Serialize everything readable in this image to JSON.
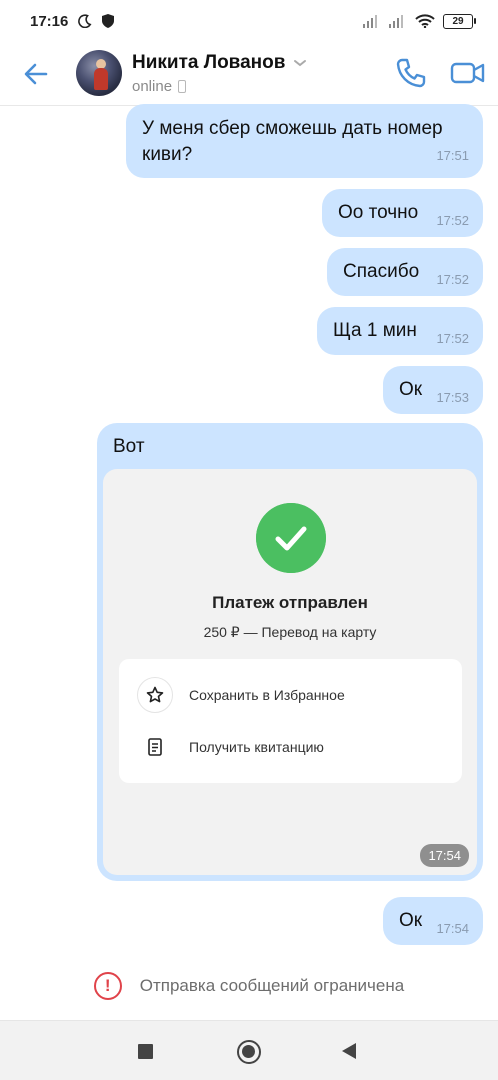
{
  "status_bar": {
    "time": "17:16",
    "battery": "29",
    "icons": [
      "moon-icon",
      "shield-icon",
      "signal-icon",
      "signal-icon",
      "wifi-icon",
      "battery-icon"
    ]
  },
  "header": {
    "contact_name": "Никита Лованов",
    "contact_status": "online",
    "icons": [
      "back-arrow-icon",
      "chevron-down-icon",
      "phone-icon",
      "video-icon"
    ],
    "accent_color": "#4a8fd6"
  },
  "messages": [
    {
      "text": "У меня сбер сможешь дать номер киви?",
      "time": "17:51"
    },
    {
      "text": "Оо точно",
      "time": "17:52"
    },
    {
      "text": "Спасибо",
      "time": "17:52"
    },
    {
      "text": "Ща 1 мин",
      "time": "17:52"
    },
    {
      "text": "Ок",
      "time": "17:53"
    },
    {
      "text": "Вот",
      "time": "17:54",
      "payment_card": {
        "title": "Платеж отправлен",
        "subtitle": "250 ₽ — Перевод на карту",
        "actions": [
          {
            "label": "Сохранить в Избранное",
            "icon": "star-icon"
          },
          {
            "label": "Получить квитанцию",
            "icon": "receipt-icon"
          }
        ],
        "status_color": "#4bbf61"
      }
    },
    {
      "text": "Ок",
      "time": "17:54"
    }
  ],
  "bubble_color": "#cce4ff",
  "notice": {
    "text": "Отправка сообщений ограничена",
    "icon": "warning-icon",
    "color": "#e0434a"
  },
  "navbar": {
    "icons": [
      "recents-icon",
      "home-icon",
      "back-icon"
    ]
  }
}
